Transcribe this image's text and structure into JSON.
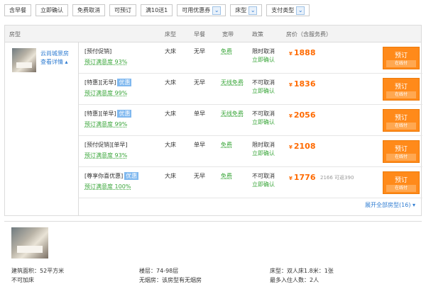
{
  "filters": [
    {
      "label": "含早餐",
      "dropdown": false
    },
    {
      "label": "立即确认",
      "dropdown": false
    },
    {
      "label": "免费取消",
      "dropdown": false
    },
    {
      "label": "可预订",
      "dropdown": false
    },
    {
      "label": "满10送1",
      "dropdown": false
    },
    {
      "label": "可用优惠券",
      "dropdown": true
    },
    {
      "label": "床型",
      "dropdown": true
    },
    {
      "label": "支付类型",
      "dropdown": true
    }
  ],
  "header": {
    "room_type": "房型",
    "bed": "床型",
    "breakfast": "早餐",
    "broadband": "宽带",
    "policy": "政策",
    "price": "房价（含服务费）"
  },
  "room": {
    "name": "云尚城景房",
    "details_link": "查看详情"
  },
  "rates": [
    {
      "name": "[预付促销]",
      "badge": "",
      "trust": "预订满意度 93%",
      "bed": "大床",
      "breakfast": "无早",
      "broadband": "免费",
      "cancel": "限时取消",
      "confirm": "立即确认",
      "currency": "¥",
      "price": "1888",
      "original": "",
      "book": "预订",
      "book_sub": "在线付"
    },
    {
      "name": "[特惠][无早]",
      "badge": "优惠",
      "trust": "预订满意度 99%",
      "bed": "大床",
      "breakfast": "无早",
      "broadband": "无线免费",
      "cancel": "不可取消",
      "confirm": "立即确认",
      "currency": "¥",
      "price": "1836",
      "original": "",
      "book": "预订",
      "book_sub": "在线付"
    },
    {
      "name": "[特惠][单早]",
      "badge": "优惠",
      "trust": "预订满意度 99%",
      "bed": "大床",
      "breakfast": "单早",
      "broadband": "无线免费",
      "cancel": "不可取消",
      "confirm": "立即确认",
      "currency": "¥",
      "price": "2056",
      "original": "",
      "book": "预订",
      "book_sub": "在线付"
    },
    {
      "name": "[预付促销][单早]",
      "badge": "",
      "trust": "预订满意度 93%",
      "bed": "大床",
      "breakfast": "单早",
      "broadband": "免费",
      "cancel": "限时取消",
      "confirm": "立即确认",
      "currency": "¥",
      "price": "2108",
      "original": "",
      "book": "预订",
      "book_sub": "在线付"
    },
    {
      "name": "[尊享你喜优惠]",
      "badge": "优惠",
      "trust": "预订满意度 100%",
      "bed": "大床",
      "breakfast": "无早",
      "broadband": "免费",
      "cancel": "不可取消",
      "confirm": "立即确认",
      "currency": "¥",
      "price": "1776",
      "original": "2166 可返390",
      "book": "预订",
      "book_sub": "在线付"
    }
  ],
  "expand_all": "展开全部房型(16) ▾",
  "room2": {
    "area": "建筑面积：52平方米",
    "floor": "楼层：74-98层",
    "bed": "床型：双人床1.8米：1张",
    "extra_bed": "不可加床",
    "smoking": "无烟房：该房型有无烟房",
    "occupancy": "最多入住人数：2人"
  }
}
